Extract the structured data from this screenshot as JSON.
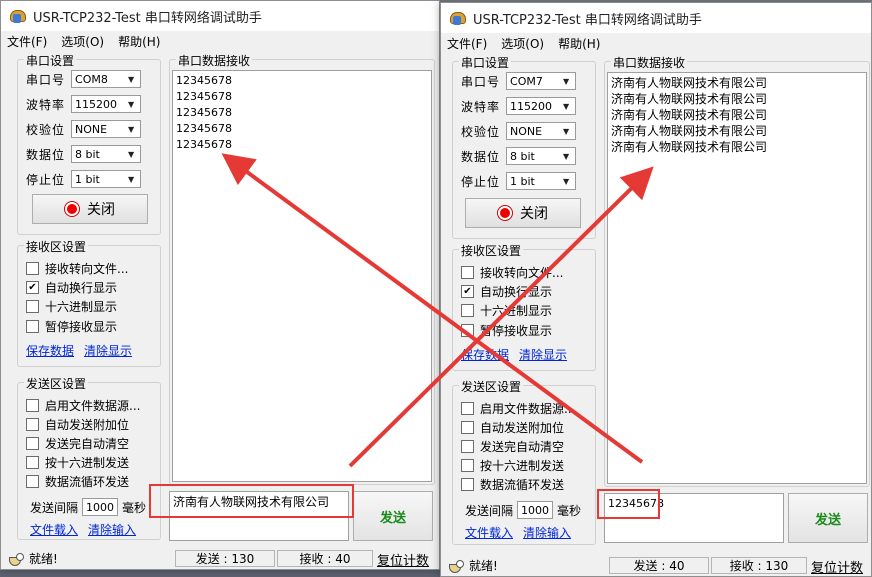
{
  "left": {
    "title": "USR-TCP232-Test 串口转网络调试助手",
    "menu": [
      "文件(F)",
      "选项(O)",
      "帮助(H)"
    ],
    "serial": {
      "title": "串口设置",
      "port_label": "串口号",
      "port": "COM8",
      "baud_label": "波特率",
      "baud": "115200",
      "parity_label": "校验位",
      "parity": "NONE",
      "data_label": "数据位",
      "data": "8 bit",
      "stop_label": "停止位",
      "stop": "1 bit",
      "close_label": "关闭"
    },
    "recv": {
      "title": "接收区设置",
      "opt1": "接收转向文件...",
      "opt2": "自动换行显示",
      "opt3": "十六进制显示",
      "opt4": "暂停接收显示",
      "save": "保存数据",
      "clear": "清除显示"
    },
    "sendset": {
      "title": "发送区设置",
      "opt1": "启用文件数据源...",
      "opt2": "自动发送附加位",
      "opt3": "发送完自动清空",
      "opt4": "按十六进制发送",
      "opt5": "数据流循环发送",
      "interval_label": "发送间隔",
      "interval": "1000",
      "interval_unit": "毫秒",
      "load": "文件载入",
      "clear": "清除输入"
    },
    "recv_panel_title": "串口数据接收",
    "recv_text": "12345678\n12345678\n12345678\n12345678\n12345678",
    "send_text": "济南有人物联网技术有限公司",
    "send_button": "发送",
    "status": {
      "ready": "就绪!",
      "sent": "发送 : 130",
      "received": "接收 : 40",
      "reset": "复位计数"
    }
  },
  "right": {
    "title": "USR-TCP232-Test 串口转网络调试助手",
    "menu": [
      "文件(F)",
      "选项(O)",
      "帮助(H)"
    ],
    "serial": {
      "title": "串口设置",
      "port_label": "串口号",
      "port": "COM7",
      "baud_label": "波特率",
      "baud": "115200",
      "parity_label": "校验位",
      "parity": "NONE",
      "data_label": "数据位",
      "data": "8 bit",
      "stop_label": "停止位",
      "stop": "1 bit",
      "close_label": "关闭"
    },
    "recv": {
      "title": "接收区设置",
      "opt1": "接收转向文件...",
      "opt2": "自动换行显示",
      "opt3": "十六进制显示",
      "opt4": "暂停接收显示",
      "save": "保存数据",
      "clear": "清除显示"
    },
    "sendset": {
      "title": "发送区设置",
      "opt1": "启用文件数据源...",
      "opt2": "自动发送附加位",
      "opt3": "发送完自动清空",
      "opt4": "按十六进制发送",
      "opt5": "数据流循环发送",
      "interval_label": "发送间隔",
      "interval": "1000",
      "interval_unit": "毫秒",
      "load": "文件载入",
      "clear": "清除输入"
    },
    "recv_panel_title": "串口数据接收",
    "recv_text": "济南有人物联网技术有限公司\n济南有人物联网技术有限公司\n济南有人物联网技术有限公司\n济南有人物联网技术有限公司\n济南有人物联网技术有限公司",
    "send_text": "12345678",
    "send_button": "发送",
    "status": {
      "ready": "就绪!",
      "sent": "发送 : 40",
      "received": "接收 : 130",
      "reset": "复位计数"
    }
  },
  "colors": {
    "annotation": "#e53935",
    "send_text": "#1a8a1a",
    "link": "#0026d6"
  },
  "icons": {
    "app": "usr-app-icon",
    "close_state": "red-dot-icon",
    "ready": "ready-hand-icon",
    "dropdown": "chevron-down-icon"
  }
}
